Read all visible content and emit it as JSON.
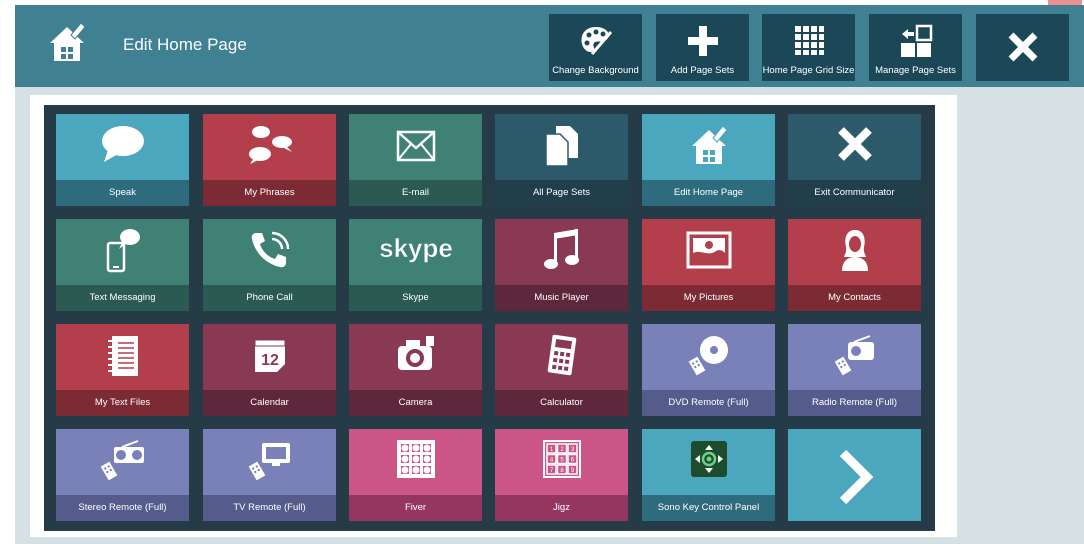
{
  "header": {
    "title": "Edit Home Page",
    "icon": "home-edit-icon"
  },
  "toolbar": [
    {
      "label": "Change Background",
      "icon": "palette-icon"
    },
    {
      "label": "Add Page Sets",
      "icon": "plus-icon"
    },
    {
      "label": "Home Page Grid Size",
      "icon": "grid-icon"
    },
    {
      "label": "Manage Page Sets",
      "icon": "manage-pages-icon"
    },
    {
      "label": "",
      "icon": "close-icon"
    }
  ],
  "tiles": [
    {
      "label": "Speak",
      "icon": "speech-bubble-icon",
      "color": "#4aa7bd",
      "band": "#2e6c7d"
    },
    {
      "label": "My Phrases",
      "icon": "phrases-icon",
      "color": "#b23f4b",
      "band": "#7c2b35"
    },
    {
      "label": "E-mail",
      "icon": "envelope-icon",
      "color": "#3f8175",
      "band": "#2a5a52"
    },
    {
      "label": "All Page Sets",
      "icon": "documents-icon",
      "color": "#2c5a6b",
      "band": "#203f4b"
    },
    {
      "label": "Edit Home Page",
      "icon": "home-edit-icon",
      "color": "#4aa7bd",
      "band": "#2e6c7d"
    },
    {
      "label": "Exit Communicator",
      "icon": "exit-x-icon",
      "color": "#2c5a6b",
      "band": "#203f4b"
    },
    {
      "label": "Text Messaging",
      "icon": "text-message-icon",
      "color": "#3f8175",
      "band": "#2a5a52"
    },
    {
      "label": "Phone Call",
      "icon": "phone-icon",
      "color": "#3f8175",
      "band": "#2a5a52"
    },
    {
      "label": "Skype",
      "icon": "skype-icon",
      "color": "#3f8175",
      "band": "#2a5a52"
    },
    {
      "label": "Music Player",
      "icon": "music-note-icon",
      "color": "#8a3955",
      "band": "#5e273b"
    },
    {
      "label": "My Pictures",
      "icon": "picture-icon",
      "color": "#b23f4b",
      "band": "#7c2b35"
    },
    {
      "label": "My Contacts",
      "icon": "contact-icon",
      "color": "#b23f4b",
      "band": "#7c2b35"
    },
    {
      "label": "My Text Files",
      "icon": "notebook-icon",
      "color": "#b23f4b",
      "band": "#7c2b35"
    },
    {
      "label": "Calendar",
      "icon": "calendar-icon",
      "color": "#8a3955",
      "band": "#5e273b"
    },
    {
      "label": "Camera",
      "icon": "camera-icon",
      "color": "#8a3955",
      "band": "#5e273b"
    },
    {
      "label": "Calculator",
      "icon": "calculator-icon",
      "color": "#8a3955",
      "band": "#5e273b"
    },
    {
      "label": "DVD Remote (Full)",
      "icon": "dvd-remote-icon",
      "color": "#7a80b8",
      "band": "#555b8b"
    },
    {
      "label": "Radio Remote (Full)",
      "icon": "radio-remote-icon",
      "color": "#7a80b8",
      "band": "#555b8b"
    },
    {
      "label": "Stereo Remote (Full)",
      "icon": "stereo-remote-icon",
      "color": "#7a80b8",
      "band": "#555b8b"
    },
    {
      "label": "TV Remote (Full)",
      "icon": "tv-remote-icon",
      "color": "#7a80b8",
      "band": "#555b8b"
    },
    {
      "label": "Fiver",
      "icon": "fiver-grid-icon",
      "color": "#cc5588",
      "band": "#94365f"
    },
    {
      "label": "Jigz",
      "icon": "jigz-grid-icon",
      "color": "#cc5588",
      "band": "#94365f"
    },
    {
      "label": "Sono Key Control Panel",
      "icon": "sono-key-icon",
      "color": "#4aa7bd",
      "band": "#2e6c7d"
    },
    {
      "label": "",
      "icon": "chevron-right-icon",
      "color": "#4aa7bd",
      "band": "#4aa7bd"
    }
  ],
  "calendar_day": "12",
  "skype_text": "skype",
  "jigz_numbers": [
    "1",
    "2",
    "3",
    "4",
    "5",
    "6",
    "7",
    "8",
    "9"
  ]
}
